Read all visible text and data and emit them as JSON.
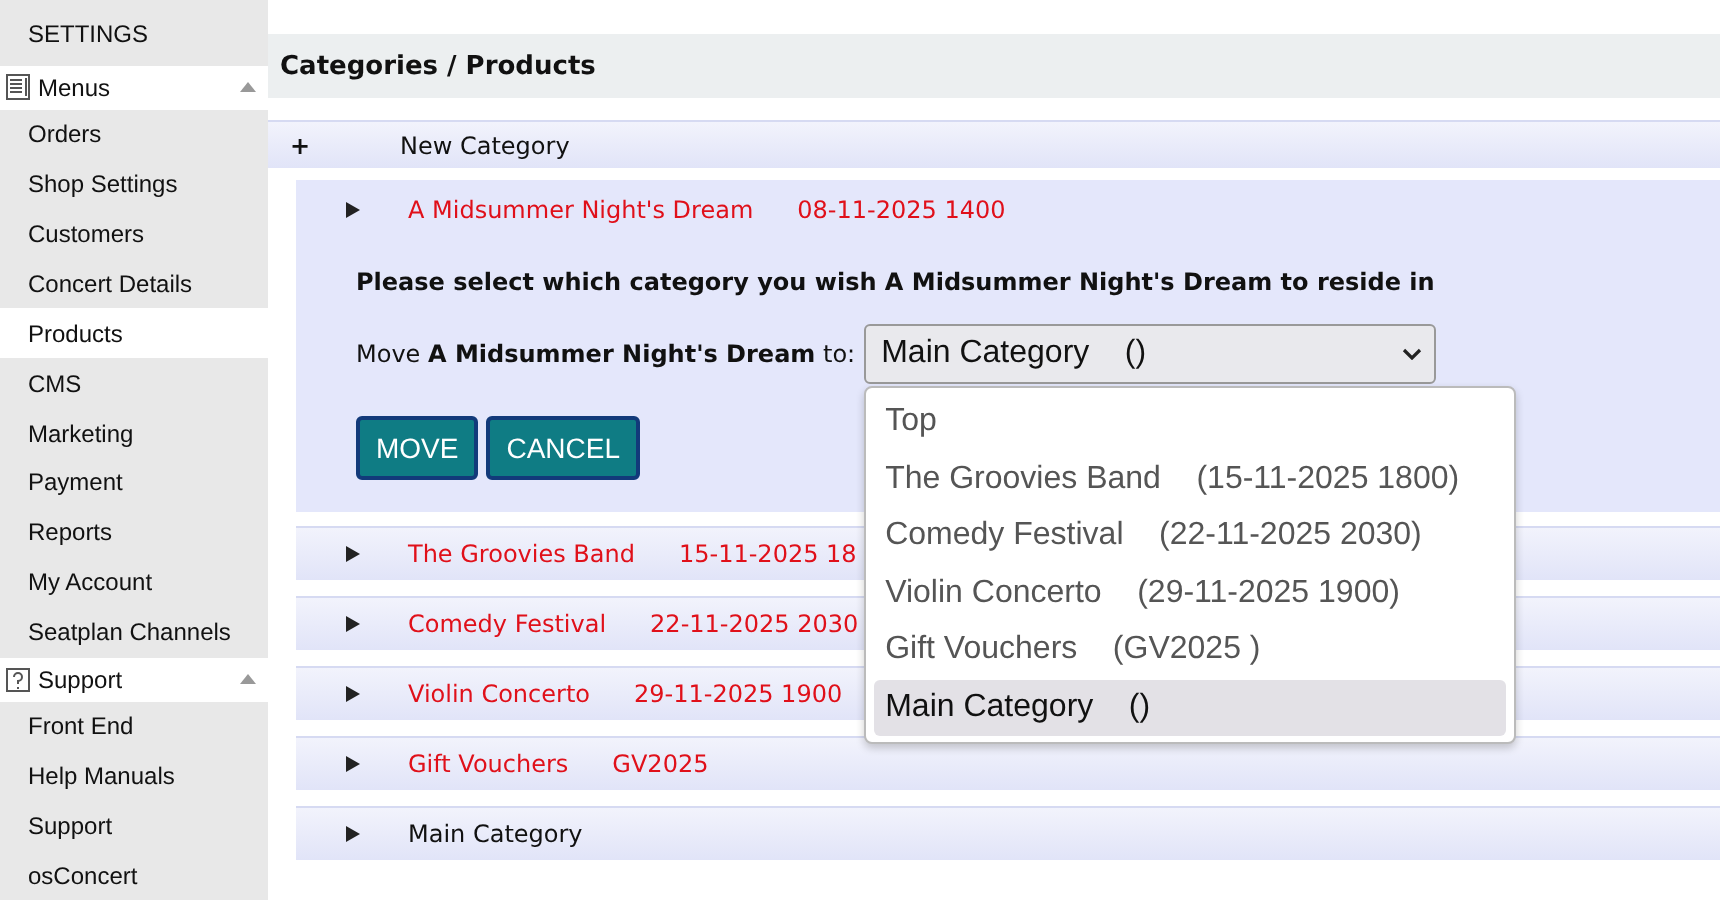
{
  "sidebar": {
    "title": "SETTINGS",
    "sections": [
      {
        "label": "Menus",
        "expanded": true,
        "items": [
          {
            "label": "Orders",
            "selected": false
          },
          {
            "label": "Shop Settings",
            "selected": false
          },
          {
            "label": "Customers",
            "selected": false
          },
          {
            "label": "Concert Details",
            "selected": false
          },
          {
            "label": "Products",
            "selected": true
          },
          {
            "label": "CMS",
            "selected": false
          },
          {
            "label": "Marketing",
            "selected": false
          },
          {
            "label": "Payment",
            "selected": false
          },
          {
            "label": "Reports",
            "selected": false
          },
          {
            "label": "My Account",
            "selected": false
          },
          {
            "label": "Seatplan Channels",
            "selected": false
          }
        ]
      },
      {
        "label": "Support",
        "expanded": true,
        "items": [
          {
            "label": "Front End",
            "selected": false
          },
          {
            "label": "Help Manuals",
            "selected": false
          },
          {
            "label": "Support",
            "selected": false
          },
          {
            "label": "osConcert",
            "selected": false
          }
        ]
      }
    ]
  },
  "page_title": "Categories / Products",
  "new_category": {
    "icon": "+",
    "label": "New Category"
  },
  "categories": [
    {
      "name": "A Midsummer Night's Dream",
      "detail": "08-11-2025 1400",
      "active": true,
      "expanded": true
    },
    {
      "name": "The Groovies Band",
      "detail": "15-11-2025 18",
      "active": true,
      "expanded": false
    },
    {
      "name": "Comedy Festival",
      "detail": "22-11-2025 2030",
      "active": true,
      "expanded": false
    },
    {
      "name": "Violin Concerto",
      "detail": "29-11-2025 1900",
      "active": true,
      "expanded": false
    },
    {
      "name": "Gift Vouchers",
      "detail": "GV2025",
      "active": true,
      "expanded": false
    },
    {
      "name": "Main Category",
      "active": false,
      "expanded": false
    }
  ],
  "move_panel": {
    "prompt": "Please select which category you wish A Midsummer Night's Dream to reside in",
    "label": "Move **A Midsummer Night's Dream** to:",
    "select_value": "Main Category    ()",
    "open": true,
    "options": [
      {
        "label": "Top",
        "selected": false
      },
      {
        "label": "The Groovies Band    (15-11-2025 1800)",
        "selected": false
      },
      {
        "label": "Comedy Festival    (22-11-2025 2030)",
        "selected": false
      },
      {
        "label": "Violin Concerto    (29-11-2025 1900)",
        "selected": false
      },
      {
        "label": "Gift Vouchers    (GV2025 )",
        "selected": false
      },
      {
        "label": "Main Category    ()",
        "selected": true
      }
    ],
    "buttons": [
      "MOVE",
      "CANCEL"
    ]
  }
}
